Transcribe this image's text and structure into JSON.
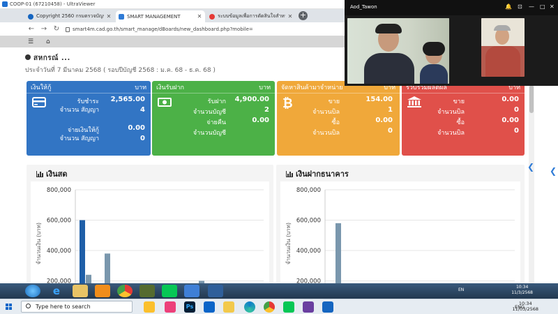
{
  "window": {
    "title": "COOP-01 (67210458) - UltraViewer"
  },
  "browser": {
    "tabs": [
      {
        "label": "Copyright 2560 กรมตรวจบัญชีสหก",
        "active": false
      },
      {
        "label": "SMART MANAGEMENT",
        "active": true
      },
      {
        "label": "ระบบข้อมูลเพื่อการตัดสินใจสำหรับ",
        "active": false
      }
    ],
    "url": "smart4m.cad.go.th/smart_manage/dBoards/new_dashboard.php?mobile="
  },
  "header": {
    "coop_name": "สหกรณ์ ...",
    "date_line": "ประจำวันที่ 7 มีนาคม 2568 ( รอบปีบัญชี 2568 : ม.ค. 68 - ธ.ค. 68 )"
  },
  "cards": {
    "loans": {
      "title": "เงินให้กู้",
      "unit": "บาท",
      "rows": [
        {
          "label": "รับชำระ",
          "value": "2,565.00"
        },
        {
          "label": "จำนวน สัญญา",
          "value": "4"
        },
        {
          "label": "จ่ายเงินให้กู้",
          "value": "0.00"
        },
        {
          "label": "จำนวน สัญญา",
          "value": "0"
        }
      ],
      "color": "#3275c4",
      "icon": "credit-card-icon"
    },
    "deposits": {
      "title": "เงินรับฝาก",
      "unit": "บาท",
      "rows": [
        {
          "label": "รับฝาก",
          "value": "4,900.00"
        },
        {
          "label": "จำนวนบัญชี",
          "value": "2"
        },
        {
          "label": "จ่ายคืน",
          "value": "0.00"
        },
        {
          "label": "จำนวนบัญชี",
          "value": "0"
        }
      ],
      "color": "#4cb147",
      "icon": "money-icon"
    },
    "sales": {
      "title": "จัดหาสินค้ามาจำหน่าย",
      "unit": "บาท",
      "rows": [
        {
          "label": "ขาย",
          "value": "154.00"
        },
        {
          "label": "จำนวนบิล",
          "value": "1"
        },
        {
          "label": "ซื้อ",
          "value": "0.00"
        },
        {
          "label": "จำนวนบิล",
          "value": "0"
        }
      ],
      "color": "#f0a83a",
      "icon": "bitcoin-icon"
    },
    "products": {
      "title": "รวบรวมผลิตผล",
      "unit": "บาท",
      "rows": [
        {
          "label": "ขาย",
          "value": "0.00"
        },
        {
          "label": "จำนวนบิล",
          "value": "0"
        },
        {
          "label": "ซื้อ",
          "value": "0.00"
        },
        {
          "label": "จำนวนบิล",
          "value": "0"
        }
      ],
      "color": "#e0504a",
      "icon": "bank-icon"
    }
  },
  "video": {
    "caller": "Aod_Tawon"
  },
  "remote_taskbar": {
    "lang": "EN",
    "time": "10:34",
    "date": "11/3/2568"
  },
  "local_taskbar": {
    "search_placeholder": "Type here to search",
    "lang": "ENG",
    "time": "10:34",
    "date": "11/03/2568"
  },
  "chart_data": [
    {
      "type": "bar",
      "title": "เงินสด",
      "ylabel": "จำนวนเงิน (บาท)",
      "ylim": [
        0,
        800000
      ],
      "y_ticks": [
        "800,000",
        "600,000",
        "400,000",
        "200,000"
      ],
      "series": [
        {
          "color": "#1f5fa8",
          "values": [
            600000,
            80000,
            0,
            25000,
            0,
            95000,
            60000,
            28000,
            0,
            15000
          ]
        },
        {
          "color": "#7a97ad",
          "values": [
            240000,
            380000,
            0,
            0,
            0,
            40000,
            200000,
            0,
            0,
            0
          ]
        }
      ]
    },
    {
      "type": "bar",
      "title": "เงินฝากธนาคาร",
      "ylabel": "จำนวนเงิน (บาท)",
      "ylim": [
        0,
        800000
      ],
      "y_ticks": [
        "800,000",
        "600,000",
        "400,000",
        "200,000"
      ],
      "series": [
        {
          "color": "#1f5fa8",
          "values": [
            0,
            15000,
            0,
            0,
            0,
            0,
            30000,
            85000,
            0,
            0
          ]
        },
        {
          "color": "#7a97ad",
          "values": [
            580000,
            0,
            0,
            0,
            0,
            0,
            0,
            0,
            0,
            0
          ]
        }
      ]
    }
  ]
}
